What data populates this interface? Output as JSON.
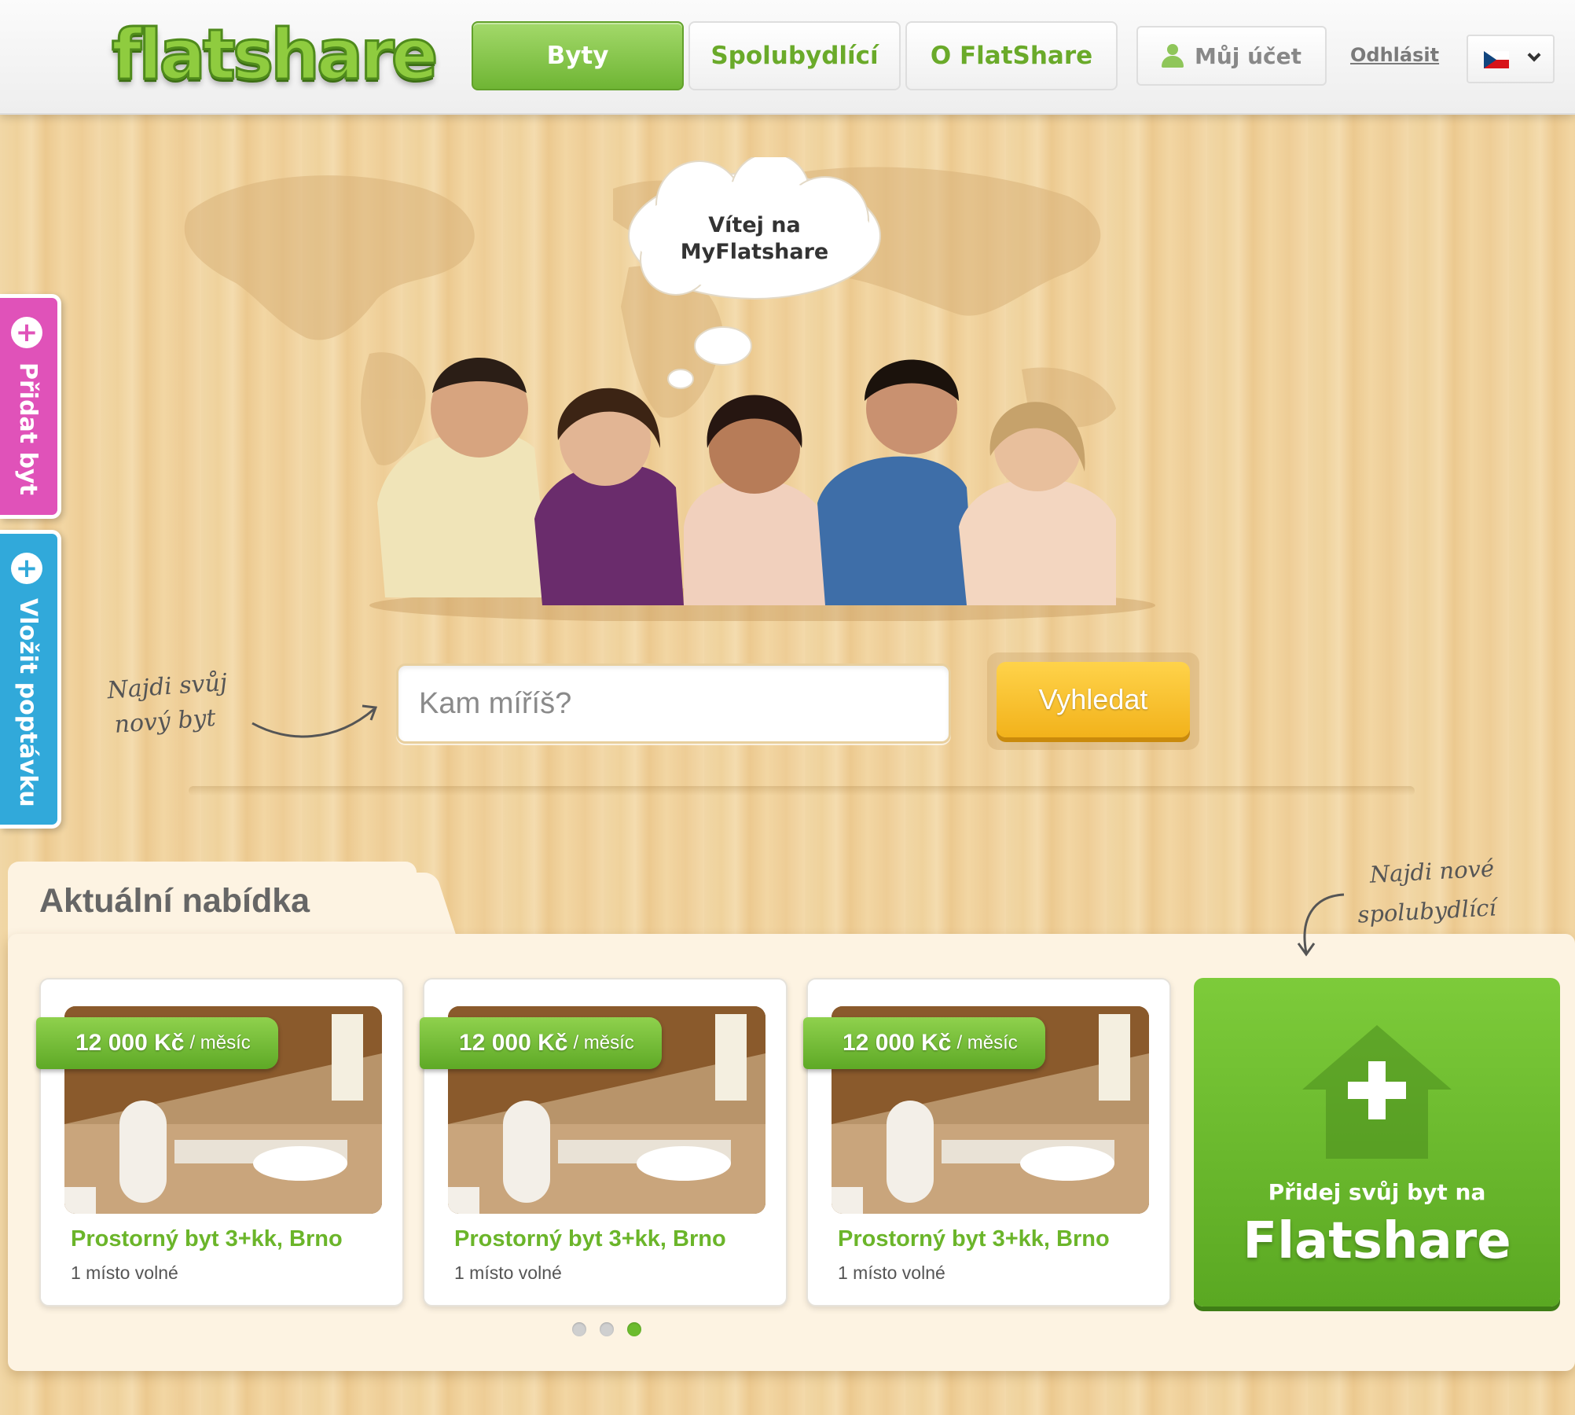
{
  "header": {
    "logo": "flatshare",
    "tabs": [
      {
        "label": "Byty",
        "active": true
      },
      {
        "label": "Spolubydlící",
        "active": false
      },
      {
        "label": "O FlatShare",
        "active": false
      }
    ],
    "account_label": "Můj účet",
    "logout_label": "Odhlásit",
    "language": {
      "flag": "cz-flag-icon",
      "selected": "CZ"
    }
  },
  "hero": {
    "bubble_line1": "Vítej na",
    "bubble_line2": "MyFlatshare",
    "hint_line1": "Najdi svůj",
    "hint_line2": "nový byt",
    "search_placeholder": "Kam míříš?",
    "search_button": "Vyhledat"
  },
  "side_tabs": [
    {
      "label": "Přidat byt",
      "color": "#e052b9"
    },
    {
      "label": "Vložit poptávku",
      "color": "#31a9da"
    }
  ],
  "offers": {
    "title": "Aktuální nabídka",
    "hint_line1": "Najdi nové",
    "hint_line2": "spolubydlící",
    "cards": [
      {
        "price": "12 000 Kč",
        "unit": "/ měsíc",
        "title": "Prostorný byt 3+kk, Brno",
        "subtitle": "1 místo volné"
      },
      {
        "price": "12 000 Kč",
        "unit": "/ měsíc",
        "title": "Prostorný byt 3+kk, Brno",
        "subtitle": "1 místo volné"
      },
      {
        "price": "12 000 Kč",
        "unit": "/ měsíc",
        "title": "Prostorný byt 3+kk, Brno",
        "subtitle": "1 místo volné"
      }
    ],
    "pagination": {
      "pages": 3,
      "active": 3
    },
    "promo": {
      "line1": "Přidej svůj byt na",
      "brand": "Flatshare"
    }
  },
  "colors": {
    "brand_green": "#6bb52a",
    "accent_yellow": "#f2b21b",
    "pink": "#e052b9",
    "blue": "#31a9da"
  }
}
